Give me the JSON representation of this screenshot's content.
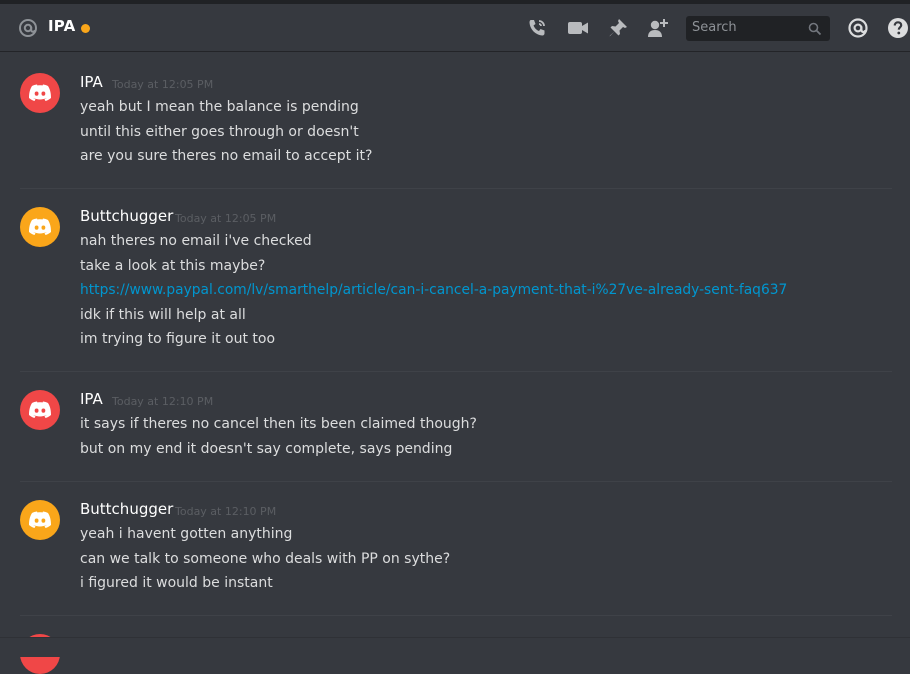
{
  "header": {
    "channel_name": "IPA",
    "status_color": "#faa61a",
    "icons": [
      "at-icon",
      "call-icon",
      "video-icon",
      "pin-icon",
      "add-friend-icon",
      "mention-icon",
      "help-icon"
    ],
    "search_placeholder": "Search"
  },
  "colors": {
    "red_avatar": "#f04747",
    "orange_avatar": "#faa61a",
    "link": "#0096cf"
  },
  "messages": [
    {
      "author": "IPA",
      "time": "Today at 12:05 PM",
      "avatar_color": "#f04747",
      "lines": [
        "yeah but I mean the balance is pending",
        "until this either goes through or doesn't",
        "are you sure theres no email to accept it?"
      ]
    },
    {
      "author": "Buttchugger",
      "time": "Today at 12:05 PM",
      "avatar_color": "#faa61a",
      "lines": [
        "nah theres no email i've checked",
        "take a look at this maybe?",
        "https://www.paypal.com/lv/smarthelp/article/can-i-cancel-a-payment-that-i%27ve-already-sent-faq637",
        "idk if this will help at all",
        "im trying to figure it out too"
      ]
    },
    {
      "author": "IPA",
      "time": "Today at 12:10 PM",
      "avatar_color": "#f04747",
      "lines": [
        "it says if theres no cancel then its been claimed though?",
        "but on my end it doesn't say complete, says pending"
      ]
    },
    {
      "author": "Buttchugger",
      "time": "Today at 12:10 PM",
      "avatar_color": "#faa61a",
      "lines": [
        "yeah i havent gotten anything",
        "can we talk to someone who deals with PP on sythe?",
        "i figured it would be instant"
      ]
    }
  ]
}
